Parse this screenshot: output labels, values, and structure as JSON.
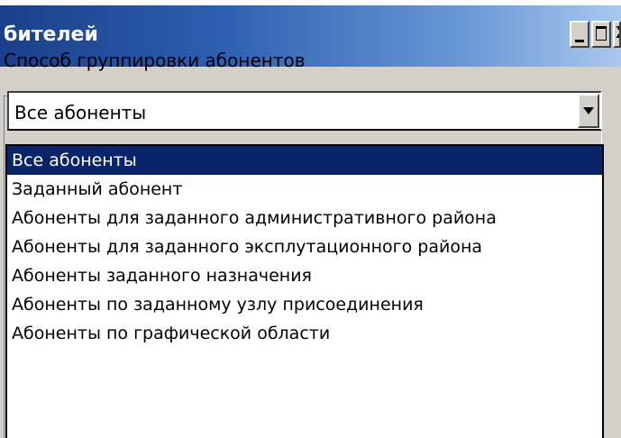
{
  "window": {
    "title": "бителей",
    "close_glyph": "X"
  },
  "group": {
    "label": "Способ группировки абонентов"
  },
  "combo": {
    "value": "Все абоненты"
  },
  "dropdown": {
    "items": [
      "Все абоненты",
      "Заданный абонент",
      "Абоненты для заданного административного района",
      "Абоненты для заданного эксплутационного района",
      "Абоненты заданного назначения",
      "Абоненты по заданному узлу присоединения",
      "Абоненты по графической области"
    ],
    "selected_index": 0
  },
  "colors": {
    "title_gradient_start": "#1a3f8a",
    "title_gradient_end": "#a8c8ee",
    "selection": "#0a246a",
    "face": "#d4d0c8"
  },
  "icons": {
    "minimize": "minimize-icon",
    "maximize": "maximize-icon",
    "close": "close-icon",
    "dropdown_arrow": "chevron-down-icon"
  }
}
